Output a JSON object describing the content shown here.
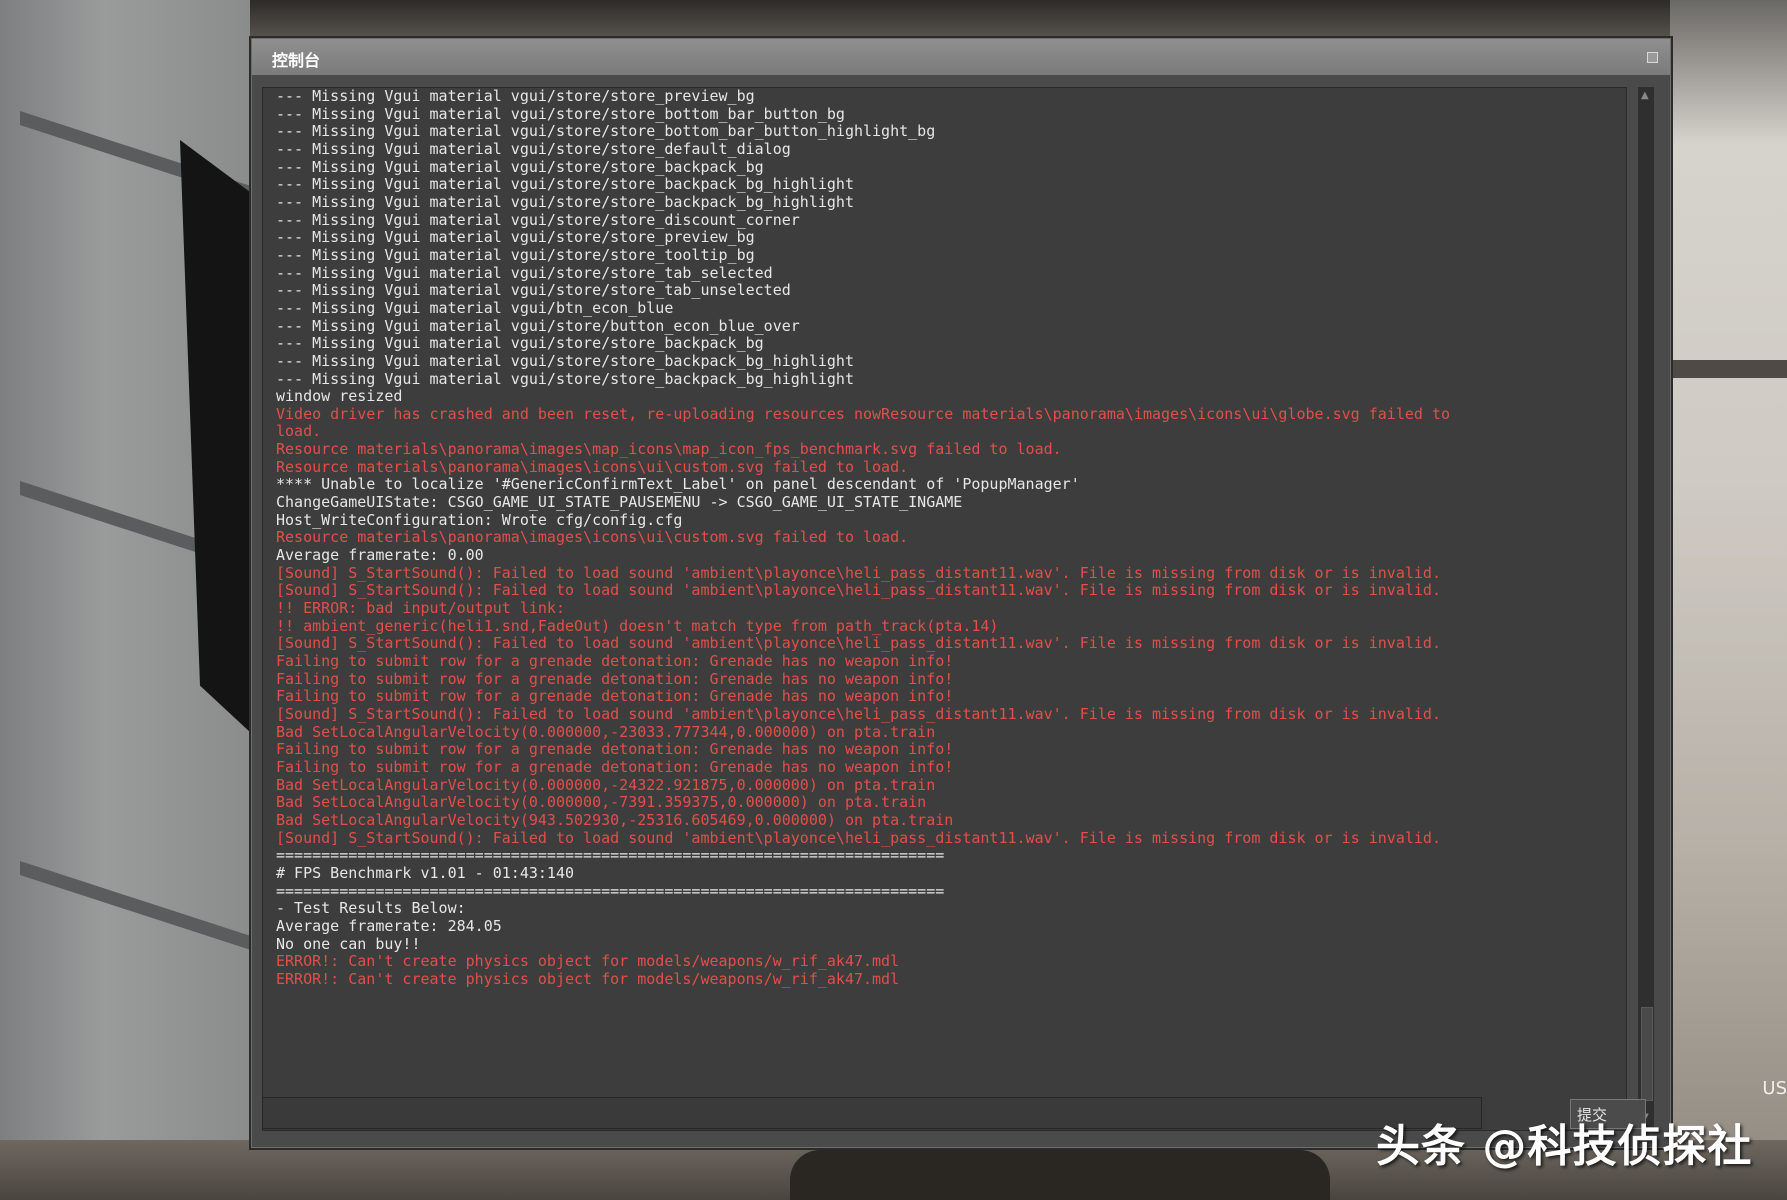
{
  "window": {
    "title": "控制台"
  },
  "log_lines": [
    {
      "text": "--- Missing Vgui material vgui/store/store_preview_bg",
      "type": "normal"
    },
    {
      "text": "--- Missing Vgui material vgui/store/store_bottom_bar_button_bg",
      "type": "normal"
    },
    {
      "text": "--- Missing Vgui material vgui/store/store_bottom_bar_button_highlight_bg",
      "type": "normal"
    },
    {
      "text": "--- Missing Vgui material vgui/store/store_default_dialog",
      "type": "normal"
    },
    {
      "text": "--- Missing Vgui material vgui/store/store_backpack_bg",
      "type": "normal"
    },
    {
      "text": "--- Missing Vgui material vgui/store/store_backpack_bg_highlight",
      "type": "normal"
    },
    {
      "text": "--- Missing Vgui material vgui/store/store_backpack_bg_highlight",
      "type": "normal"
    },
    {
      "text": "--- Missing Vgui material vgui/store/store_discount_corner",
      "type": "normal"
    },
    {
      "text": "--- Missing Vgui material vgui/store/store_preview_bg",
      "type": "normal"
    },
    {
      "text": "--- Missing Vgui material vgui/store/store_tooltip_bg",
      "type": "normal"
    },
    {
      "text": "--- Missing Vgui material vgui/store/store_tab_selected",
      "type": "normal"
    },
    {
      "text": "--- Missing Vgui material vgui/store/store_tab_unselected",
      "type": "normal"
    },
    {
      "text": "--- Missing Vgui material vgui/btn_econ_blue",
      "type": "normal"
    },
    {
      "text": "--- Missing Vgui material vgui/store/button_econ_blue_over",
      "type": "normal"
    },
    {
      "text": "--- Missing Vgui material vgui/store/store_backpack_bg",
      "type": "normal"
    },
    {
      "text": "--- Missing Vgui material vgui/store/store_backpack_bg_highlight",
      "type": "normal"
    },
    {
      "text": "--- Missing Vgui material vgui/store/store_backpack_bg_highlight",
      "type": "normal"
    },
    {
      "text": "window resized",
      "type": "normal"
    },
    {
      "text": "Video driver has crashed and been reset, re-uploading resources nowResource materials\\panorama\\images\\icons\\ui\\globe.svg failed to",
      "type": "error"
    },
    {
      "text": "load.",
      "type": "error"
    },
    {
      "text": "Resource materials\\panorama\\images\\map_icons\\map_icon_fps_benchmark.svg failed to load.",
      "type": "error"
    },
    {
      "text": "Resource materials\\panorama\\images\\icons\\ui\\custom.svg failed to load.",
      "type": "error"
    },
    {
      "text": "**** Unable to localize '#GenericConfirmText_Label' on panel descendant of 'PopupManager'",
      "type": "normal"
    },
    {
      "text": "ChangeGameUIState: CSGO_GAME_UI_STATE_PAUSEMENU -> CSGO_GAME_UI_STATE_INGAME",
      "type": "normal"
    },
    {
      "text": "Host_WriteConfiguration: Wrote cfg/config.cfg",
      "type": "normal"
    },
    {
      "text": "Resource materials\\panorama\\images\\icons\\ui\\custom.svg failed to load.",
      "type": "error"
    },
    {
      "text": "Average framerate: 0.00",
      "type": "normal"
    },
    {
      "text": "[Sound] S_StartSound(): Failed to load sound 'ambient\\playonce\\heli_pass_distant11.wav'. File is missing from disk or is invalid.",
      "type": "error"
    },
    {
      "text": "[Sound] S_StartSound(): Failed to load sound 'ambient\\playonce\\heli_pass_distant11.wav'. File is missing from disk or is invalid.",
      "type": "error"
    },
    {
      "text": "!! ERROR: bad input/output link:",
      "type": "error"
    },
    {
      "text": "!! ambient_generic(heli1.snd,FadeOut) doesn't match type from path_track(pta.14)",
      "type": "error"
    },
    {
      "text": "[Sound] S_StartSound(): Failed to load sound 'ambient\\playonce\\heli_pass_distant11.wav'. File is missing from disk or is invalid.",
      "type": "error"
    },
    {
      "text": "Failing to submit row for a grenade detonation: Grenade has no weapon info!",
      "type": "error"
    },
    {
      "text": "Failing to submit row for a grenade detonation: Grenade has no weapon info!",
      "type": "error"
    },
    {
      "text": "Failing to submit row for a grenade detonation: Grenade has no weapon info!",
      "type": "error"
    },
    {
      "text": "[Sound] S_StartSound(): Failed to load sound 'ambient\\playonce\\heli_pass_distant11.wav'. File is missing from disk or is invalid.",
      "type": "error"
    },
    {
      "text": "Bad SetLocalAngularVelocity(0.000000,-23033.777344,0.000000) on pta.train",
      "type": "error"
    },
    {
      "text": "Failing to submit row for a grenade detonation: Grenade has no weapon info!",
      "type": "error"
    },
    {
      "text": "Failing to submit row for a grenade detonation: Grenade has no weapon info!",
      "type": "error"
    },
    {
      "text": "Bad SetLocalAngularVelocity(0.000000,-24322.921875,0.000000) on pta.train",
      "type": "error"
    },
    {
      "text": "Bad SetLocalAngularVelocity(0.000000,-7391.359375,0.000000) on pta.train",
      "type": "error"
    },
    {
      "text": "Bad SetLocalAngularVelocity(943.502930,-25316.605469,0.000000) on pta.train",
      "type": "error"
    },
    {
      "text": "[Sound] S_StartSound(): Failed to load sound 'ambient\\playonce\\heli_pass_distant11.wav'. File is missing from disk or is invalid.",
      "type": "error"
    },
    {
      "text": "",
      "type": "normal"
    },
    {
      "text": "",
      "type": "normal"
    },
    {
      "text": "",
      "type": "normal"
    },
    {
      "text": "==========================================================================",
      "type": "normal"
    },
    {
      "text": "# FPS Benchmark v1.01 - 01:43:140",
      "type": "normal"
    },
    {
      "text": "==========================================================================",
      "type": "normal"
    },
    {
      "text": "- Test Results Below:",
      "type": "normal"
    },
    {
      "text": "",
      "type": "normal"
    },
    {
      "text": "Average framerate: 284.05",
      "type": "normal"
    },
    {
      "text": "No one can buy!!",
      "type": "normal"
    },
    {
      "text": "ERROR!: Can't create physics object for models/weapons/w_rif_ak47.mdl",
      "type": "error"
    },
    {
      "text": "ERROR!: Can't create physics object for models/weapons/w_rif_ak47.mdl",
      "type": "error"
    }
  ],
  "input": {
    "value": "",
    "submit_label": "提交"
  },
  "overlay": {
    "watermark": "头条 @科技侦探社",
    "corner_label": "US"
  },
  "colors": {
    "normal_text": "#e6e6e6",
    "error_text": "#e0504a"
  }
}
